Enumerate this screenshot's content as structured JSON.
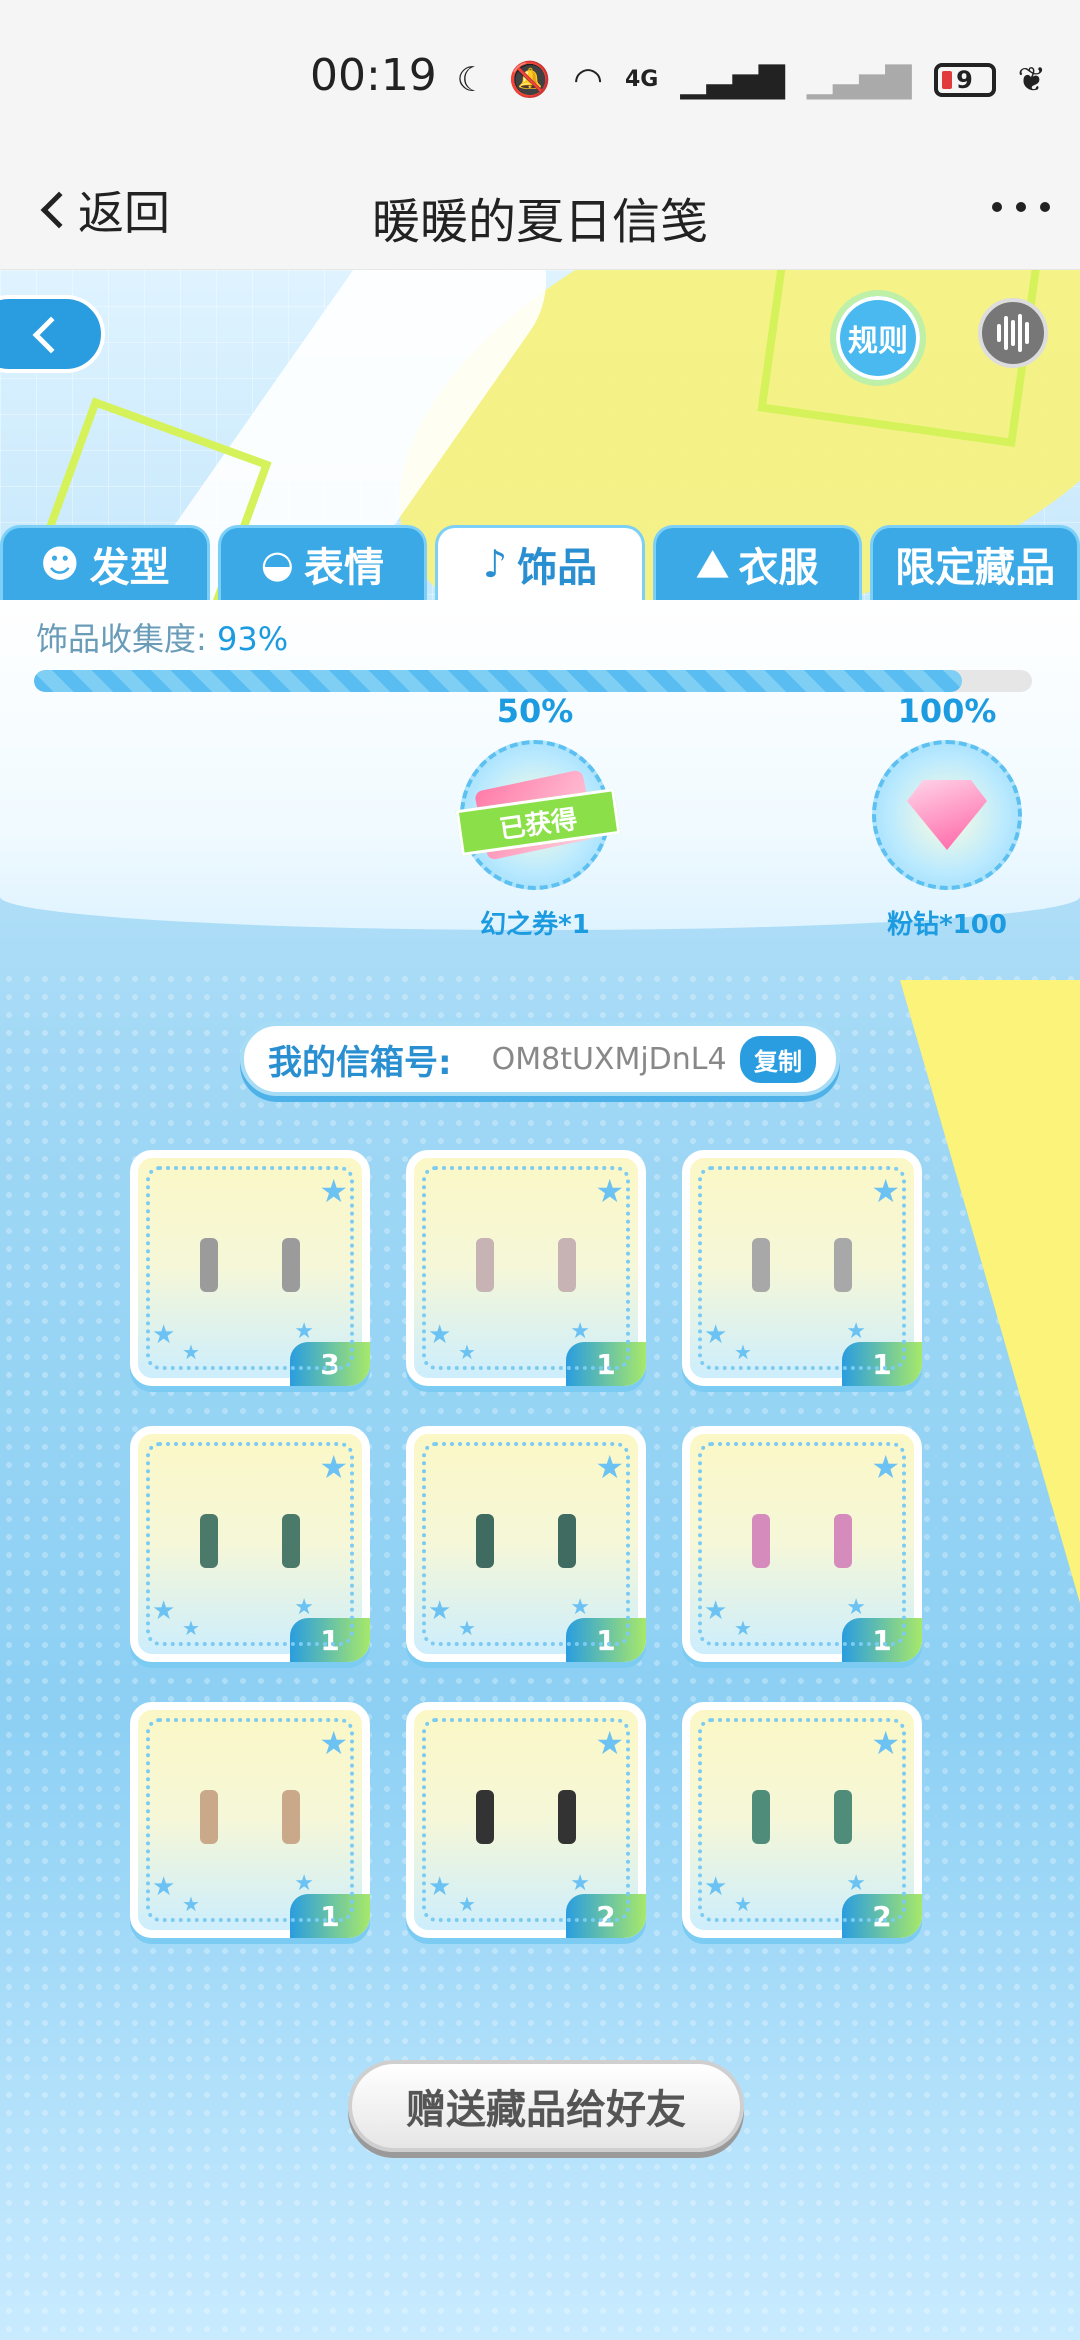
{
  "status": {
    "time": "00:19",
    "network": "4G",
    "battery": "9"
  },
  "nav": {
    "back_label": "返回",
    "title": "暖暖的夏日信笺"
  },
  "game": {
    "rules_label": "规则",
    "tabs": [
      {
        "label": "发型",
        "icon": "hair-icon"
      },
      {
        "label": "表情",
        "icon": "mask-icon"
      },
      {
        "label": "饰品",
        "icon": "earring-icon"
      },
      {
        "label": "衣服",
        "icon": "dress-icon"
      },
      {
        "label": "限定藏品",
        "icon": ""
      }
    ],
    "active_tab": "饰品",
    "progress": {
      "label": "饰品收集度:",
      "value": "93%",
      "fraction": 0.93
    },
    "milestones": [
      {
        "pct": "50%",
        "reward": "幻之券*1",
        "status": "已获得",
        "icon": "ticket-icon"
      },
      {
        "pct": "100%",
        "reward": "粉钻*100",
        "icon": "pink-diamond-icon"
      }
    ],
    "mailbox": {
      "label": "我的信箱号:",
      "id": "OM8tUXMjDnL4",
      "copy_label": "复制"
    },
    "items": [
      {
        "count": "3",
        "color": "#9b9b9b"
      },
      {
        "count": "1",
        "color": "#c7b3b3"
      },
      {
        "count": "1",
        "color": "#a8a8a8"
      },
      {
        "count": "1",
        "color": "#4c7a6a"
      },
      {
        "count": "1",
        "color": "#3f6b61"
      },
      {
        "count": "1",
        "color": "#d68bbd"
      },
      {
        "count": "1",
        "color": "#c9a98a"
      },
      {
        "count": "2",
        "color": "#333333"
      },
      {
        "count": "2",
        "color": "#4f8c7a"
      }
    ],
    "gift_label": "赠送藏品给好友"
  }
}
